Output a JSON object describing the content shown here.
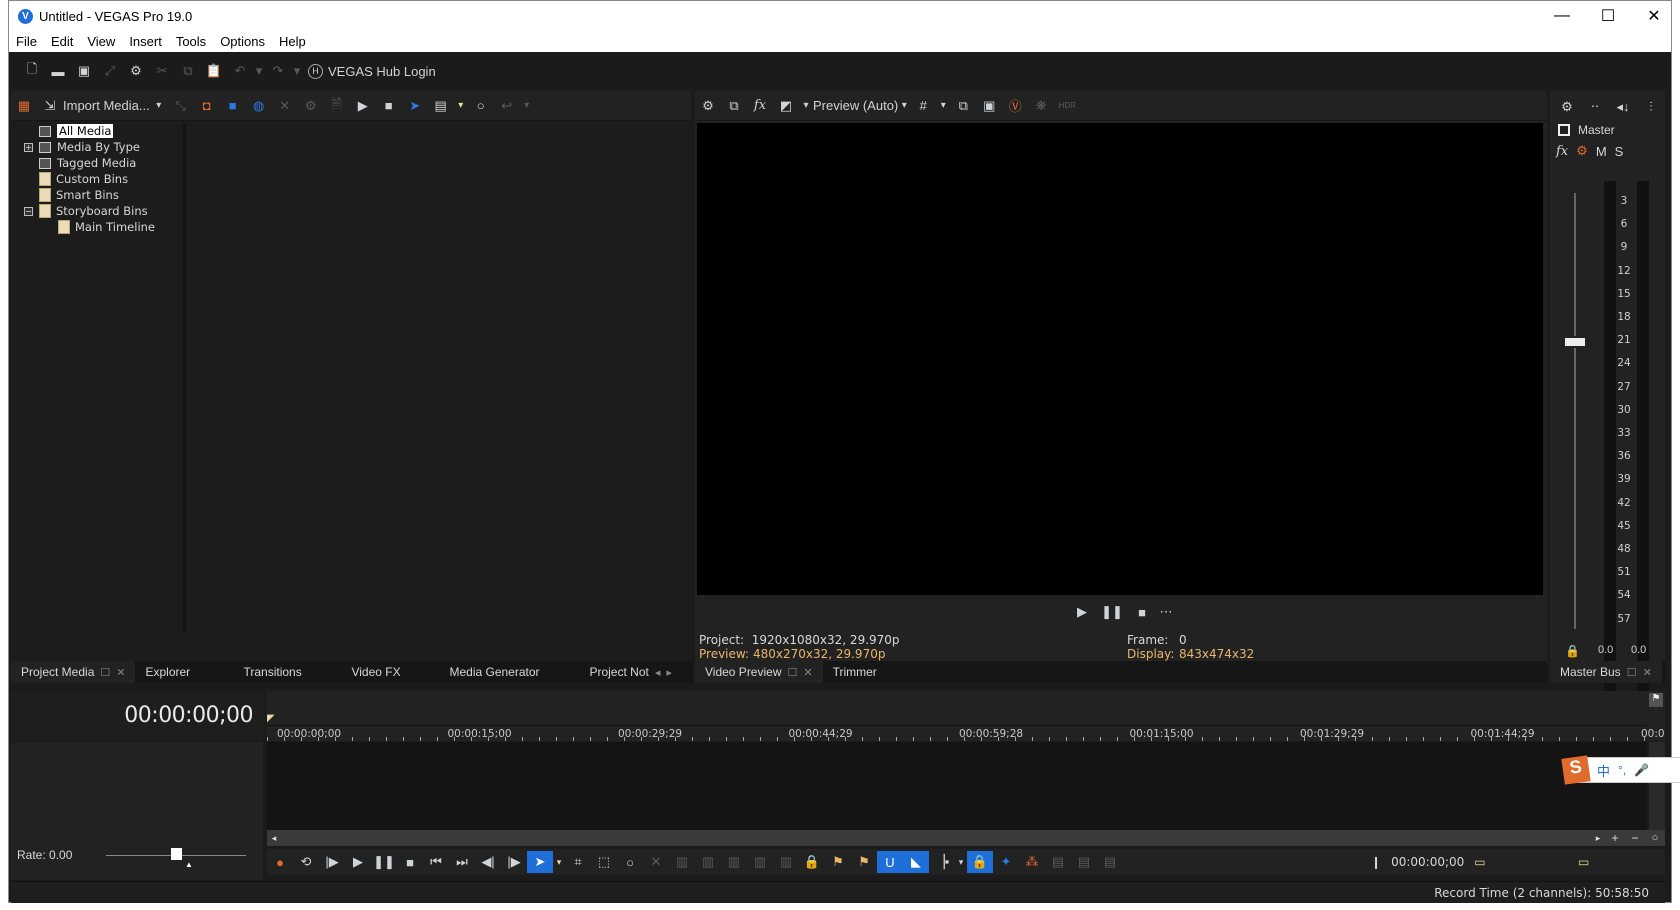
{
  "window": {
    "title": "Untitled - VEGAS Pro 19.0",
    "app_icon": "V",
    "controls": {
      "minimize": "—",
      "maximize": "☐",
      "close": "✕"
    }
  },
  "menu": [
    "File",
    "Edit",
    "View",
    "Insert",
    "Tools",
    "Options",
    "Help"
  ],
  "main_toolbar": {
    "icons": [
      "new-icon",
      "open-icon",
      "save-icon",
      "render-icon",
      "settings-icon",
      "cut-icon",
      "copy-icon",
      "paste-icon",
      "undo-icon",
      "redo-icon"
    ],
    "hub_login": "VEGAS Hub Login"
  },
  "media_panel": {
    "import_label": "Import Media...",
    "tree": [
      {
        "label": "All Media",
        "selected": true,
        "expander": ""
      },
      {
        "label": "Media By Type",
        "expander": "+"
      },
      {
        "label": "Tagged Media",
        "expander": ""
      },
      {
        "label": "Custom Bins",
        "expander": ""
      },
      {
        "label": "Smart Bins",
        "expander": ""
      },
      {
        "label": "Storyboard Bins",
        "expander": "−"
      },
      {
        "label": "Main Timeline",
        "expander": ""
      }
    ]
  },
  "preview": {
    "mode": "Preview (Auto)",
    "project_label": "Project:",
    "project_value": "1920x1080x32, 29.970p",
    "preview_label": "Preview:",
    "preview_value": "480x270x32, 29.970p",
    "frame_label": "Frame:",
    "frame_value": "0",
    "display_label": "Display:",
    "display_value": "843x474x32"
  },
  "master": {
    "label": "Master",
    "fx": "fx",
    "m": "M",
    "s": "S",
    "scale": [
      "3",
      "6",
      "9",
      "12",
      "15",
      "18",
      "21",
      "24",
      "27",
      "30",
      "33",
      "36",
      "39",
      "42",
      "45",
      "48",
      "51",
      "54",
      "57"
    ],
    "left_value": "0.0",
    "right_value": "0.0"
  },
  "dock_tabs": {
    "left": [
      "Project Media",
      "Explorer",
      "Transitions",
      "Video FX",
      "Media Generator",
      "Project Not"
    ],
    "center": [
      "Video Preview",
      "Trimmer"
    ],
    "right": [
      "Master Bus"
    ]
  },
  "timeline": {
    "timecode": "00:00:00;00",
    "ruler": [
      "00:00:00;00",
      "00:00:15;00",
      "00:00:29;29",
      "00:00:44;29",
      "00:00:59;28",
      "00:01:15;00",
      "00:01:29;29",
      "00:01:44;29",
      "00:0"
    ],
    "rate_label": "Rate: 0.00",
    "cursor_time": "00:00:00;00",
    "status": "Record Time (2 channels): 50:58:50"
  },
  "ime": {
    "logo": "S",
    "lang": "中",
    "punct": "°,",
    "mic": "🎤"
  }
}
